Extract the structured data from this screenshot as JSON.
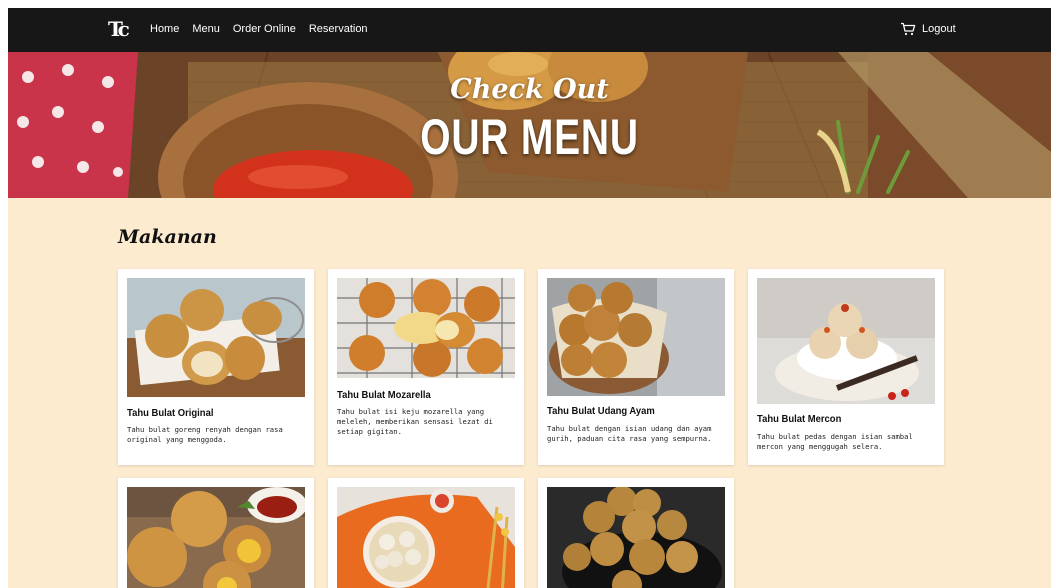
{
  "nav": {
    "logo": "Tc",
    "links": [
      "Home",
      "Menu",
      "Order Online",
      "Reservation"
    ],
    "logout_label": "Logout",
    "cart_icon": "cart-icon"
  },
  "hero": {
    "line1": "Check Out",
    "line2": "OUR MENU"
  },
  "section": {
    "title": "Makanan"
  },
  "items": [
    {
      "name": "Tahu Bulat Original",
      "desc": "Tahu bulat goreng renyah dengan rasa original yang menggoda."
    },
    {
      "name": "Tahu Bulat Mozarella",
      "desc": "Tahu bulat isi keju mozarella yang meleleh, memberikan sensasi lezat di setiap gigitan."
    },
    {
      "name": "Tahu Bulat Udang Ayam",
      "desc": "Tahu bulat dengan isian udang dan ayam gurih, paduan cita rasa yang sempurna."
    },
    {
      "name": "Tahu Bulat Mercon",
      "desc": "Tahu bulat pedas dengan isian sambal mercon yang menggugah selera."
    }
  ],
  "colors": {
    "nav_bg": "#171717",
    "page_bg": "#fdebd0"
  }
}
